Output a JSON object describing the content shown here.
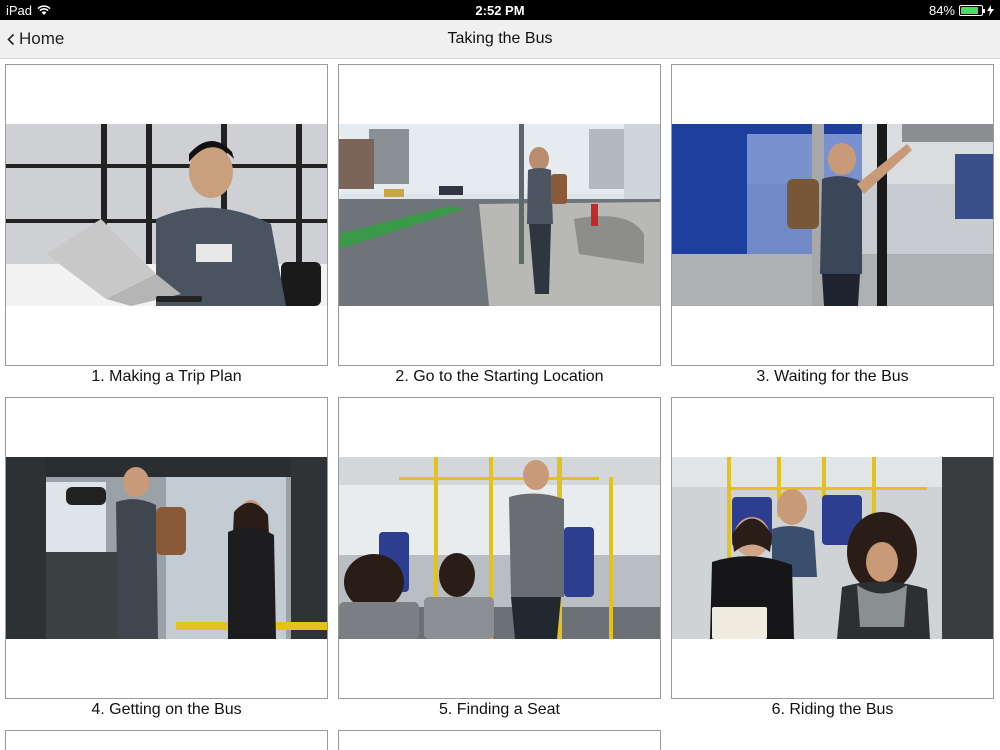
{
  "status_bar": {
    "device": "iPad",
    "time": "2:52 PM",
    "battery_percent": "84%",
    "battery_level": 0.84
  },
  "nav": {
    "back_label": "Home",
    "title": "Taking the Bus"
  },
  "tiles": [
    {
      "caption": "1. Making a Trip Plan"
    },
    {
      "caption": "2. Go to the Starting Location"
    },
    {
      "caption": "3. Waiting for the Bus"
    },
    {
      "caption": "4. Getting on the Bus"
    },
    {
      "caption": "5. Finding a Seat"
    },
    {
      "caption": "6. Riding the Bus"
    }
  ]
}
